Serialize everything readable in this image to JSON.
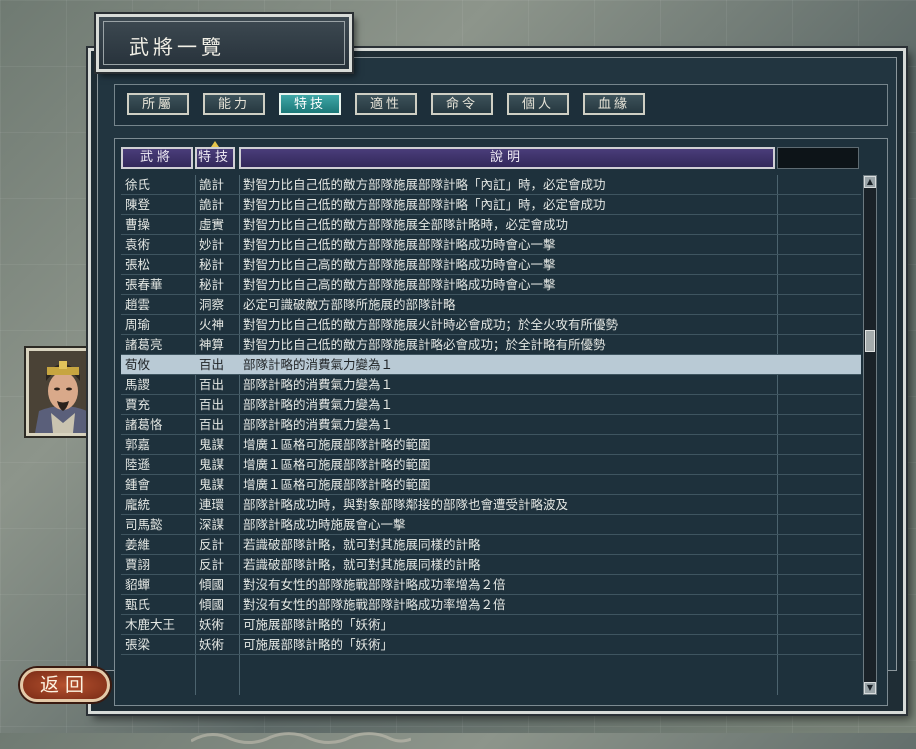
{
  "title": "武將一覽",
  "tabs": [
    {
      "label": "所屬",
      "active": false
    },
    {
      "label": "能力",
      "active": false
    },
    {
      "label": "特技",
      "active": true
    },
    {
      "label": "適性",
      "active": false
    },
    {
      "label": "命令",
      "active": false
    },
    {
      "label": "個人",
      "active": false
    },
    {
      "label": "血緣",
      "active": false
    }
  ],
  "table": {
    "headers": {
      "name": "武將",
      "skill": "特技",
      "desc": "說明"
    },
    "sorted_column": "skill",
    "selected_row": 10,
    "rows": [
      {
        "name": "徐氏",
        "skill": "詭計",
        "desc": "對智力比自己低的敵方部隊施展部隊計略「內訌」時，必定會成功"
      },
      {
        "name": "陳登",
        "skill": "詭計",
        "desc": "對智力比自己低的敵方部隊施展部隊計略「內訌」時，必定會成功"
      },
      {
        "name": "曹操",
        "skill": "虛實",
        "desc": "對智力比自己低的敵方部隊施展全部隊計略時，必定會成功"
      },
      {
        "name": "袁術",
        "skill": "妙計",
        "desc": "對智力比自己低的敵方部隊施展部隊計略成功時會心一擊"
      },
      {
        "name": "張松",
        "skill": "秘計",
        "desc": "對智力比自己高的敵方部隊施展部隊計略成功時會心一擊"
      },
      {
        "name": "張春華",
        "skill": "秘計",
        "desc": "對智力比自己高的敵方部隊施展部隊計略成功時會心一擊"
      },
      {
        "name": "趙雲",
        "skill": "洞察",
        "desc": "必定可識破敵方部隊所施展的部隊計略"
      },
      {
        "name": "周瑜",
        "skill": "火神",
        "desc": "對智力比自己低的敵方部隊施展火計時必會成功；於全火攻有所優勢"
      },
      {
        "name": "諸葛亮",
        "skill": "神算",
        "desc": "對智力比自己低的敵方部隊施展計略必會成功；於全計略有所優勢"
      },
      {
        "name": "荀攸",
        "skill": "百出",
        "desc": "部隊計略的消費氣力變為１"
      },
      {
        "name": "馬謖",
        "skill": "百出",
        "desc": "部隊計略的消費氣力變為１"
      },
      {
        "name": "賈充",
        "skill": "百出",
        "desc": "部隊計略的消費氣力變為１"
      },
      {
        "name": "諸葛恪",
        "skill": "百出",
        "desc": "部隊計略的消費氣力變為１"
      },
      {
        "name": "郭嘉",
        "skill": "鬼謀",
        "desc": "增廣１區格可施展部隊計略的範圍"
      },
      {
        "name": "陸遜",
        "skill": "鬼謀",
        "desc": "增廣１區格可施展部隊計略的範圍"
      },
      {
        "name": "鍾會",
        "skill": "鬼謀",
        "desc": "增廣１區格可施展部隊計略的範圍"
      },
      {
        "name": "龐統",
        "skill": "連環",
        "desc": "部隊計略成功時，與對象部隊鄰接的部隊也會遭受計略波及"
      },
      {
        "name": "司馬懿",
        "skill": "深謀",
        "desc": "部隊計略成功時施展會心一擊"
      },
      {
        "name": "姜維",
        "skill": "反計",
        "desc": "若識破部隊計略，就可對其施展同樣的計略"
      },
      {
        "name": "賈詡",
        "skill": "反計",
        "desc": "若識破部隊計略，就可對其施展同樣的計略"
      },
      {
        "name": "貂蟬",
        "skill": "傾國",
        "desc": "對沒有女性的部隊施戰部隊計略成功率增為２倍"
      },
      {
        "name": "甄氏",
        "skill": "傾國",
        "desc": "對沒有女性的部隊施戰部隊計略成功率增為２倍"
      },
      {
        "name": "木鹿大王",
        "skill": "妖術",
        "desc": "可施展部隊計略的「妖術」"
      },
      {
        "name": "張梁",
        "skill": "妖術",
        "desc": "可施展部隊計略的「妖術」"
      }
    ]
  },
  "scroll_position": 0.3,
  "back_button": "返回",
  "icons": {
    "portrait": "officer-portrait",
    "scroll_up": "arrow-up-icon",
    "scroll_down": "arrow-down-icon"
  },
  "colors": {
    "active_tab": "#2a8f8f",
    "header": "#3b2f68",
    "selected_row": "#b9cad5",
    "back_button": "#9a3f22"
  }
}
